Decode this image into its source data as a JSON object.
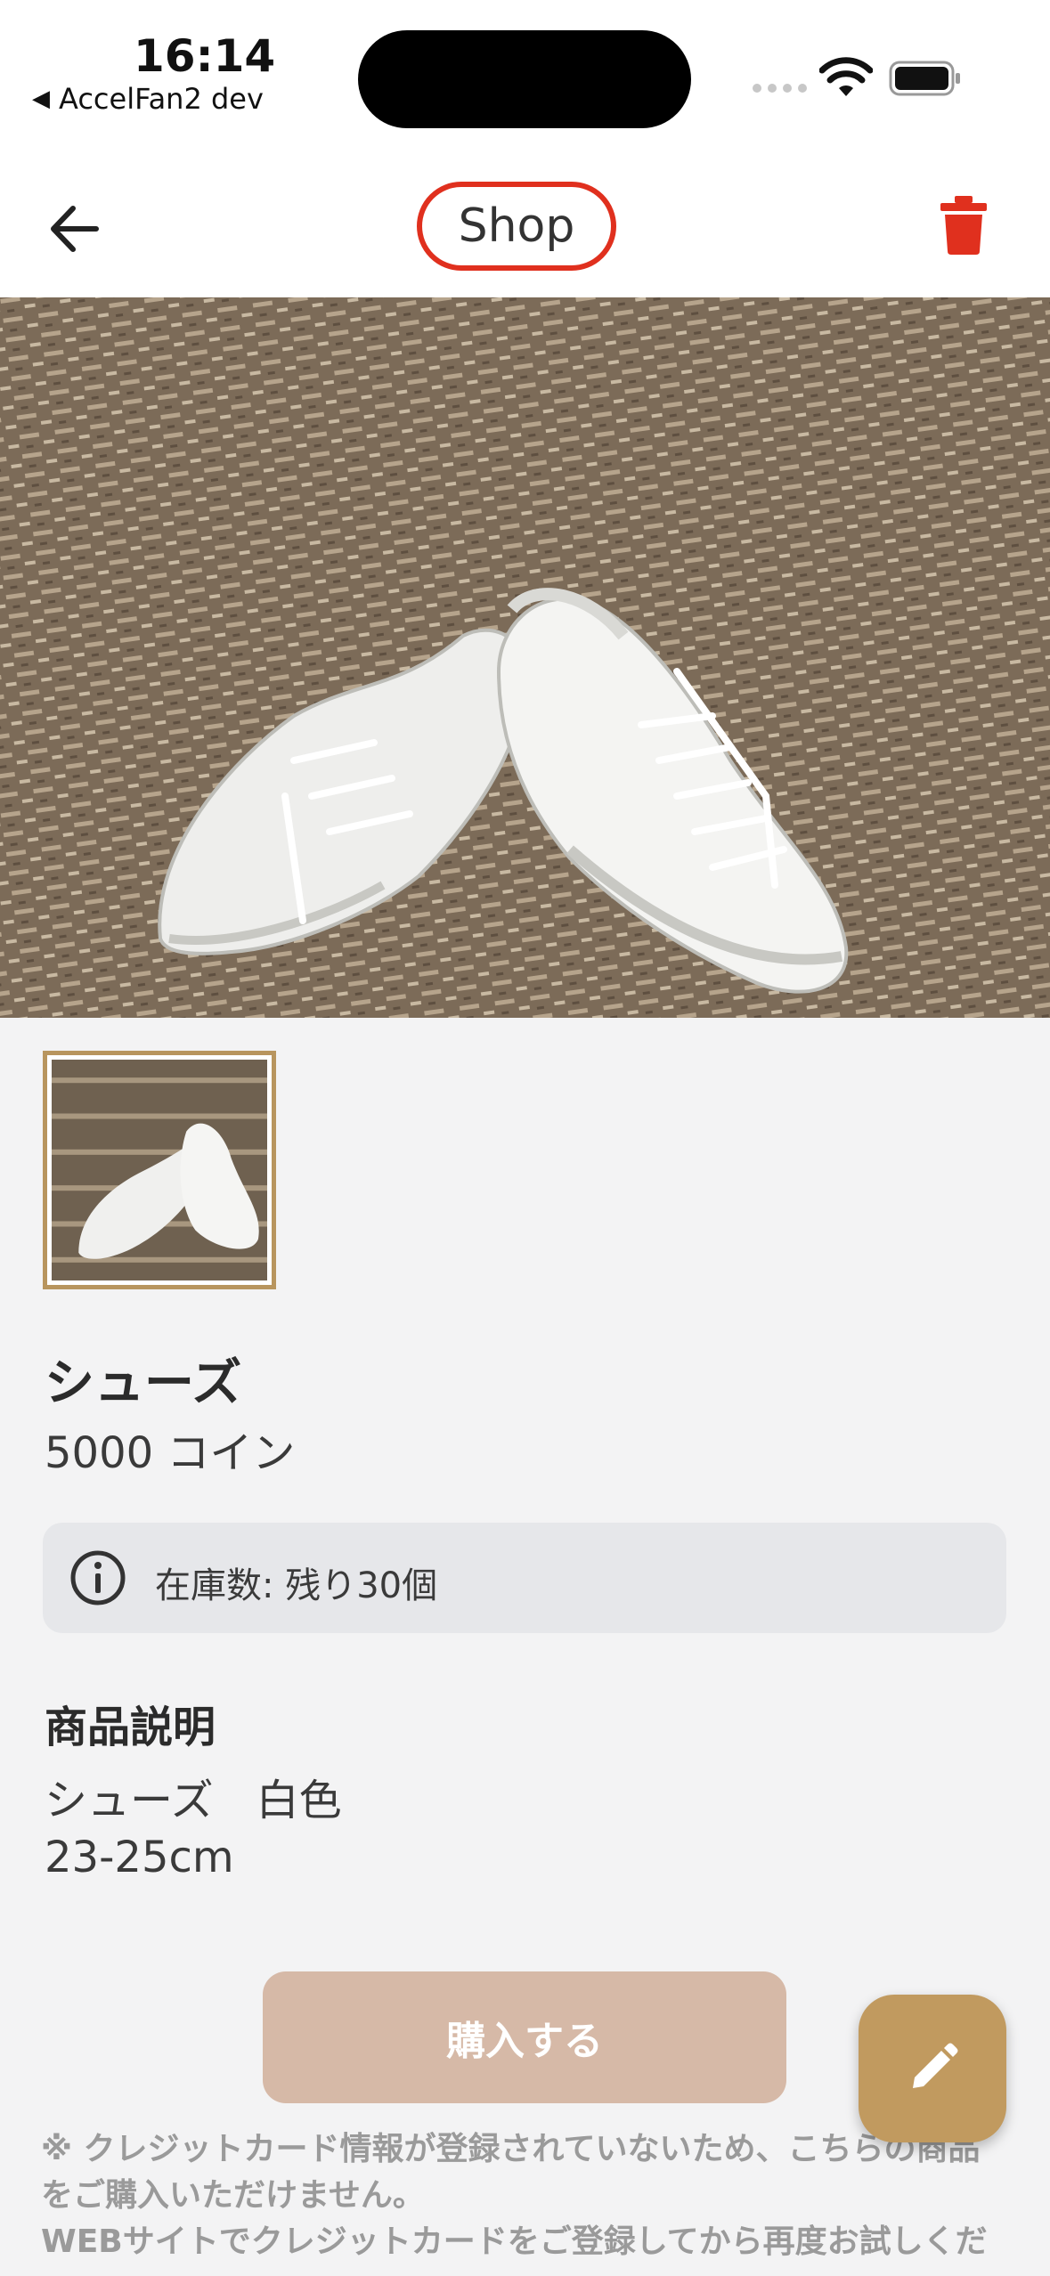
{
  "status_bar": {
    "time": "16:14",
    "back_app": "AccelFan2 dev",
    "icons": [
      "signal-icon",
      "wifi-icon",
      "battery-icon"
    ]
  },
  "nav": {
    "title": "Shop",
    "back_icon": "arrow-left-icon",
    "delete_icon": "trash-icon",
    "accent_color": "#e0301e"
  },
  "product": {
    "name": "シューズ",
    "price": "5000 コイン",
    "stock": "在庫数: 残り30個",
    "description_title": "商品説明",
    "description_line1": "シューズ　白色",
    "description_line2": "23-25cm"
  },
  "actions": {
    "buy_label": "購入する",
    "buy_color": "#d6b9a7",
    "edit_icon": "pencil-icon",
    "fab_color": "#c19a5f"
  },
  "notice": {
    "line1": "※ クレジットカード情報が登録されていないため、こちらの商品",
    "line2": "をご購入いただけません。",
    "line3": "WEBサイトでクレジットカードをご登録してから再度お試しくだ"
  }
}
